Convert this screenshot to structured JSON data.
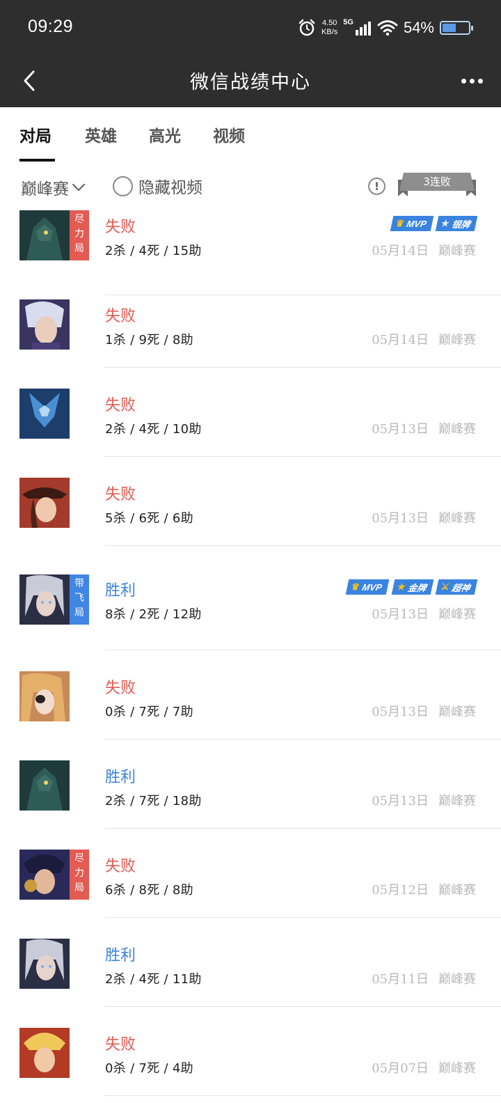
{
  "status_bar": {
    "time": "09:29",
    "net_speed_value": "4.50",
    "net_speed_unit": "KB/s",
    "network": "5G",
    "battery_percent": "54%",
    "battery_level": 0.54
  },
  "nav": {
    "title": "微信战绩中心"
  },
  "tabs": [
    {
      "label": "对局",
      "active": true
    },
    {
      "label": "英雄",
      "active": false
    },
    {
      "label": "高光",
      "active": false
    },
    {
      "label": "视频",
      "active": false
    }
  ],
  "filter": {
    "mode": "巅峰赛",
    "hide_video_label": "隐藏视频",
    "info_symbol": "!",
    "streak": "3连败"
  },
  "matches": [
    {
      "result": "失败",
      "outcome": "lose",
      "kda": "2杀 / 4死 / 15助",
      "date": "05月14日",
      "mode": "巅峰赛",
      "ribbon": "尽力局",
      "ribbon_color": "#e35b52",
      "badges": [
        {
          "icon": "trophy-icon",
          "label": "MVP"
        },
        {
          "icon": "silver-medal-icon",
          "label": "银牌"
        }
      ]
    },
    {
      "result": "失败",
      "outcome": "lose",
      "kda": "1杀 / 9死 / 8助",
      "date": "05月14日",
      "mode": "巅峰赛",
      "ribbon": "",
      "badges": []
    },
    {
      "result": "失败",
      "outcome": "lose",
      "kda": "2杀 / 4死 / 10助",
      "date": "05月13日",
      "mode": "巅峰赛",
      "ribbon": "",
      "badges": []
    },
    {
      "result": "失败",
      "outcome": "lose",
      "kda": "5杀 / 6死 / 6助",
      "date": "05月13日",
      "mode": "巅峰赛",
      "ribbon": "",
      "badges": []
    },
    {
      "result": "胜利",
      "outcome": "win",
      "kda": "8杀 / 2死 / 12助",
      "date": "05月13日",
      "mode": "巅峰赛",
      "ribbon": "带飞局",
      "ribbon_color": "#4186e3",
      "badges": [
        {
          "icon": "trophy-icon",
          "label": "MVP"
        },
        {
          "icon": "gold-medal-icon",
          "label": "金牌"
        },
        {
          "icon": "sword-icon",
          "label": "超神"
        }
      ]
    },
    {
      "result": "失败",
      "outcome": "lose",
      "kda": "0杀 / 7死 / 7助",
      "date": "05月13日",
      "mode": "巅峰赛",
      "ribbon": "",
      "badges": []
    },
    {
      "result": "胜利",
      "outcome": "win",
      "kda": "2杀 / 7死 / 18助",
      "date": "05月13日",
      "mode": "巅峰赛",
      "ribbon": "",
      "badges": []
    },
    {
      "result": "失败",
      "outcome": "lose",
      "kda": "6杀 / 8死 / 8助",
      "date": "05月12日",
      "mode": "巅峰赛",
      "ribbon": "尽力局",
      "ribbon_color": "#e35b52",
      "badges": []
    },
    {
      "result": "胜利",
      "outcome": "win",
      "kda": "2杀 / 4死 / 11助",
      "date": "05月11日",
      "mode": "巅峰赛",
      "ribbon": "",
      "badges": []
    },
    {
      "result": "失败",
      "outcome": "lose",
      "kda": "0杀 / 7死 / 4助",
      "date": "05月07日",
      "mode": "巅峰赛",
      "ribbon": "",
      "badges": []
    }
  ],
  "colors": {
    "lose": "#e35b52",
    "win": "#3f84d6",
    "badge": "#3a84e0",
    "header": "#2e2e2e"
  }
}
